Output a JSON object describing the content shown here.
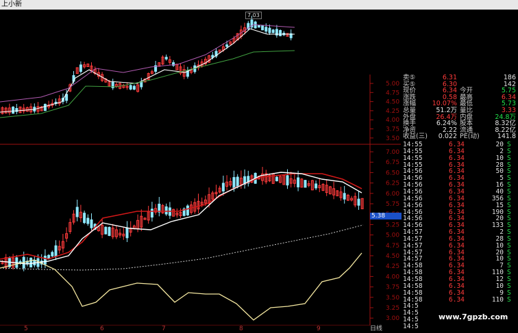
{
  "window": {
    "title": "上小新"
  },
  "colors": {
    "up": "#ff3b3b",
    "down": "#8fe8ff",
    "ma_white": "#ffffff",
    "ma_red": "#d01818",
    "ma_green": "#40a040",
    "ma_purple": "#b05ab0",
    "ma_dotted": "#cccccc",
    "osc": "#f4e7a0",
    "axis": "#a01010"
  },
  "upper_axis": {
    "labels": [
      "5.00",
      "4.75",
      "4.50",
      "4.25",
      "4.00",
      "3.75",
      "3.50"
    ],
    "max_label": "7.03"
  },
  "lower_axis": {
    "labels": [
      "7.00",
      "6.75",
      "6.50",
      "6.25",
      "6.00",
      "5.75",
      "5.50",
      "5.25",
      "5.00",
      "4.75",
      "4.50",
      "4.25",
      "4.00",
      "3.75",
      "3.50",
      "3.25",
      "3.00"
    ],
    "current_price": "5.38"
  },
  "date_ticks": [
    "5",
    "6",
    "7",
    "8",
    "9"
  ],
  "bottom_label": "日线",
  "quote": {
    "rows": [
      {
        "l1": "卖⑤",
        "v1": "6.31",
        "c1": "red",
        "l2": "",
        "v2": "186",
        "c2": "white"
      },
      {
        "l1": "买⑤",
        "v1": "6.30",
        "c1": "red",
        "l2": "",
        "v2": "142",
        "c2": "white"
      },
      {
        "l1": "现价",
        "v1": "6.34",
        "c1": "red",
        "l2": "今开",
        "v2": "5.75",
        "c2": "green"
      },
      {
        "l1": "涨跌",
        "v1": "0.58",
        "c1": "red",
        "l2": "最高",
        "v2": "6.34",
        "c2": "red"
      },
      {
        "l1": "涨幅",
        "v1": "10.07%",
        "c1": "red",
        "l2": "最低",
        "v2": "5.73",
        "c2": "green"
      },
      {
        "l1": "总量",
        "v1": "51.2万",
        "c1": "white",
        "l2": "量比",
        "v2": "3.33",
        "c2": "red"
      },
      {
        "l1": "外盘",
        "v1": "26.4万",
        "c1": "red",
        "l2": "内盘",
        "v2": "24.8万",
        "c2": "green"
      },
      {
        "l1": "换手",
        "v1": "6.24%",
        "c1": "white",
        "l2": "股本",
        "v2": "8.32亿",
        "c2": "white"
      },
      {
        "l1": "净资",
        "v1": "2.22",
        "c1": "white",
        "l2": "流通",
        "v2": "8.22亿",
        "c2": "white"
      },
      {
        "l1": "收益(三)",
        "v1": "0.022",
        "c1": "white",
        "l2": "PE(动)",
        "v2": "141.8",
        "c2": "white"
      }
    ]
  },
  "ticks": [
    {
      "time": "14:55",
      "price": "6.34",
      "vol": "20",
      "side": "S"
    },
    {
      "time": "14:55",
      "price": "6.34",
      "vol": "2",
      "side": "S"
    },
    {
      "time": "14:55",
      "price": "6.34",
      "vol": "10",
      "side": "S"
    },
    {
      "time": "14:55",
      "price": "6.34",
      "vol": "28",
      "side": "S"
    },
    {
      "time": "14:56",
      "price": "6.34",
      "vol": "50",
      "side": "S"
    },
    {
      "time": "14:56",
      "price": "6.34",
      "vol": "5",
      "side": "S"
    },
    {
      "time": "14:56",
      "price": "6.34",
      "vol": "16",
      "side": "S"
    },
    {
      "time": "14:56",
      "price": "6.34",
      "vol": "40",
      "side": "S"
    },
    {
      "time": "14:56",
      "price": "6.34",
      "vol": "356",
      "side": "S"
    },
    {
      "time": "14:56",
      "price": "6.34",
      "vol": "15",
      "side": "S"
    },
    {
      "time": "14:56",
      "price": "6.34",
      "vol": "190",
      "side": "S"
    },
    {
      "time": "14:56",
      "price": "6.34",
      "vol": "20",
      "side": "S"
    },
    {
      "time": "14:56",
      "price": "6.34",
      "vol": "133",
      "side": "S"
    },
    {
      "time": "14:57",
      "price": "6.34",
      "vol": "2",
      "side": "S"
    },
    {
      "time": "14:57",
      "price": "6.34",
      "vol": "28",
      "side": "S"
    },
    {
      "time": "14:57",
      "price": "6.34",
      "vol": "10",
      "side": "S"
    },
    {
      "time": "14:57",
      "price": "6.34",
      "vol": "20",
      "side": "S"
    },
    {
      "time": "14:57",
      "price": "6.34",
      "vol": "10",
      "side": "S"
    },
    {
      "time": "14:58",
      "price": "6.34",
      "vol": "7",
      "side": "S"
    },
    {
      "time": "14:58",
      "price": "6.34",
      "vol": "110",
      "side": "S"
    },
    {
      "time": "14:58",
      "price": "6.34",
      "vol": "12",
      "side": "S"
    },
    {
      "time": "14:58",
      "price": "6.34",
      "vol": "10",
      "side": "S"
    },
    {
      "time": "14:58",
      "price": "6.34",
      "vol": "9",
      "side": "S"
    },
    {
      "time": "14:58",
      "price": "6.34",
      "vol": "110",
      "side": "S"
    },
    {
      "time": "14:5",
      "price": "",
      "vol": "",
      "side": ""
    },
    {
      "time": "14:5",
      "price": "",
      "vol": "",
      "side": ""
    },
    {
      "time": "14:5",
      "price": "",
      "vol": "",
      "side": ""
    },
    {
      "time": "14:5",
      "price": "",
      "vol": "",
      "side": ""
    }
  ],
  "watermark": "www.7gpzb.com"
}
